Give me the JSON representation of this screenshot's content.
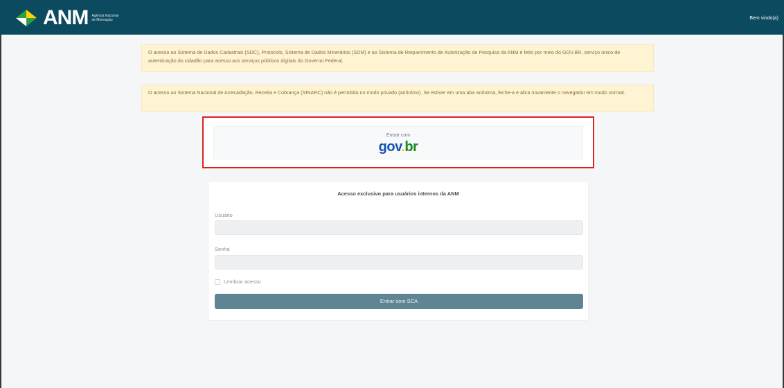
{
  "header": {
    "brand": "ANM",
    "brand_sub": "Agência Nacional de Mineração",
    "welcome": "Bem vindo(a)",
    "bg_color": "#0c4a60"
  },
  "alerts": [
    {
      "text": "O acesso ao Sistema de Dados Cadastrais (SDC), Protocolo, Sistema de Dados Minerários (SDM) e ao Sistema de Requerimento de Autorização de Pesquisa da ANM é feito por meio do GOV.BR, serviço único de autenticação do cidadão para acesso aos serviços públicos digitais do Governo Federal."
    },
    {
      "text": "O acesso ao Sistema Nacional de Arrecadação, Receita e Cobrança (SINARC) não é permitido no modo privado (anônimo). Se estiver em uma aba anônima, feche-a e abra novamente o navegador em modo normal."
    }
  ],
  "govbr": {
    "label": "Entrar com",
    "logo_parts": [
      "gov",
      ".",
      "br"
    ]
  },
  "login": {
    "title": "Acesso exclusivo para usuários internos da ANM",
    "user_label": "Usuário",
    "user_value": "",
    "pass_label": "Senha",
    "pass_value": "",
    "remember_label": "Lembrar acesso",
    "submit_label": "Entrar com SCA"
  },
  "colors": {
    "alert_bg": "#fef4d3",
    "highlight_border": "#e02020",
    "submit_bg": "#5f8595"
  }
}
